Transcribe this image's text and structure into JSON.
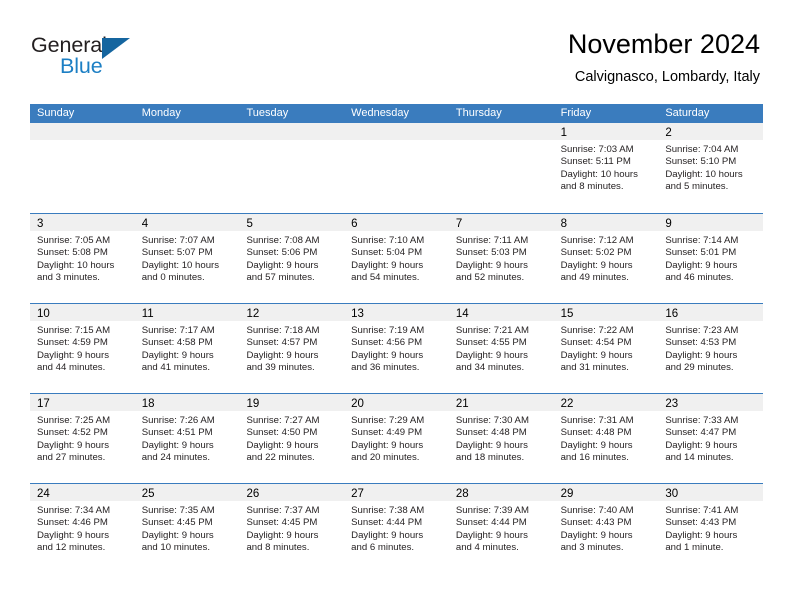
{
  "brand": {
    "name_part1": "General",
    "name_part2": "Blue"
  },
  "header": {
    "title": "November 2024",
    "location": "Calvignasco, Lombardy, Italy"
  },
  "colors": {
    "header_blue": "#3a7cbe",
    "day_band_gray": "#f0f0f0",
    "brand_dark": "#231f20",
    "brand_blue": "#1c7fc4",
    "logo_triangle": "#15659f"
  },
  "calendar": {
    "weekdays": [
      "Sunday",
      "Monday",
      "Tuesday",
      "Wednesday",
      "Thursday",
      "Friday",
      "Saturday"
    ],
    "weeks": [
      [
        {
          "day": "",
          "empty": true
        },
        {
          "day": "",
          "empty": true
        },
        {
          "day": "",
          "empty": true
        },
        {
          "day": "",
          "empty": true
        },
        {
          "day": "",
          "empty": true
        },
        {
          "day": "1",
          "sunrise": "Sunrise: 7:03 AM",
          "sunset": "Sunset: 5:11 PM",
          "daylight_line1": "Daylight: 10 hours",
          "daylight_line2": "and 8 minutes."
        },
        {
          "day": "2",
          "sunrise": "Sunrise: 7:04 AM",
          "sunset": "Sunset: 5:10 PM",
          "daylight_line1": "Daylight: 10 hours",
          "daylight_line2": "and 5 minutes."
        }
      ],
      [
        {
          "day": "3",
          "sunrise": "Sunrise: 7:05 AM",
          "sunset": "Sunset: 5:08 PM",
          "daylight_line1": "Daylight: 10 hours",
          "daylight_line2": "and 3 minutes."
        },
        {
          "day": "4",
          "sunrise": "Sunrise: 7:07 AM",
          "sunset": "Sunset: 5:07 PM",
          "daylight_line1": "Daylight: 10 hours",
          "daylight_line2": "and 0 minutes."
        },
        {
          "day": "5",
          "sunrise": "Sunrise: 7:08 AM",
          "sunset": "Sunset: 5:06 PM",
          "daylight_line1": "Daylight: 9 hours",
          "daylight_line2": "and 57 minutes."
        },
        {
          "day": "6",
          "sunrise": "Sunrise: 7:10 AM",
          "sunset": "Sunset: 5:04 PM",
          "daylight_line1": "Daylight: 9 hours",
          "daylight_line2": "and 54 minutes."
        },
        {
          "day": "7",
          "sunrise": "Sunrise: 7:11 AM",
          "sunset": "Sunset: 5:03 PM",
          "daylight_line1": "Daylight: 9 hours",
          "daylight_line2": "and 52 minutes."
        },
        {
          "day": "8",
          "sunrise": "Sunrise: 7:12 AM",
          "sunset": "Sunset: 5:02 PM",
          "daylight_line1": "Daylight: 9 hours",
          "daylight_line2": "and 49 minutes."
        },
        {
          "day": "9",
          "sunrise": "Sunrise: 7:14 AM",
          "sunset": "Sunset: 5:01 PM",
          "daylight_line1": "Daylight: 9 hours",
          "daylight_line2": "and 46 minutes."
        }
      ],
      [
        {
          "day": "10",
          "sunrise": "Sunrise: 7:15 AM",
          "sunset": "Sunset: 4:59 PM",
          "daylight_line1": "Daylight: 9 hours",
          "daylight_line2": "and 44 minutes."
        },
        {
          "day": "11",
          "sunrise": "Sunrise: 7:17 AM",
          "sunset": "Sunset: 4:58 PM",
          "daylight_line1": "Daylight: 9 hours",
          "daylight_line2": "and 41 minutes."
        },
        {
          "day": "12",
          "sunrise": "Sunrise: 7:18 AM",
          "sunset": "Sunset: 4:57 PM",
          "daylight_line1": "Daylight: 9 hours",
          "daylight_line2": "and 39 minutes."
        },
        {
          "day": "13",
          "sunrise": "Sunrise: 7:19 AM",
          "sunset": "Sunset: 4:56 PM",
          "daylight_line1": "Daylight: 9 hours",
          "daylight_line2": "and 36 minutes."
        },
        {
          "day": "14",
          "sunrise": "Sunrise: 7:21 AM",
          "sunset": "Sunset: 4:55 PM",
          "daylight_line1": "Daylight: 9 hours",
          "daylight_line2": "and 34 minutes."
        },
        {
          "day": "15",
          "sunrise": "Sunrise: 7:22 AM",
          "sunset": "Sunset: 4:54 PM",
          "daylight_line1": "Daylight: 9 hours",
          "daylight_line2": "and 31 minutes."
        },
        {
          "day": "16",
          "sunrise": "Sunrise: 7:23 AM",
          "sunset": "Sunset: 4:53 PM",
          "daylight_line1": "Daylight: 9 hours",
          "daylight_line2": "and 29 minutes."
        }
      ],
      [
        {
          "day": "17",
          "sunrise": "Sunrise: 7:25 AM",
          "sunset": "Sunset: 4:52 PM",
          "daylight_line1": "Daylight: 9 hours",
          "daylight_line2": "and 27 minutes."
        },
        {
          "day": "18",
          "sunrise": "Sunrise: 7:26 AM",
          "sunset": "Sunset: 4:51 PM",
          "daylight_line1": "Daylight: 9 hours",
          "daylight_line2": "and 24 minutes."
        },
        {
          "day": "19",
          "sunrise": "Sunrise: 7:27 AM",
          "sunset": "Sunset: 4:50 PM",
          "daylight_line1": "Daylight: 9 hours",
          "daylight_line2": "and 22 minutes."
        },
        {
          "day": "20",
          "sunrise": "Sunrise: 7:29 AM",
          "sunset": "Sunset: 4:49 PM",
          "daylight_line1": "Daylight: 9 hours",
          "daylight_line2": "and 20 minutes."
        },
        {
          "day": "21",
          "sunrise": "Sunrise: 7:30 AM",
          "sunset": "Sunset: 4:48 PM",
          "daylight_line1": "Daylight: 9 hours",
          "daylight_line2": "and 18 minutes."
        },
        {
          "day": "22",
          "sunrise": "Sunrise: 7:31 AM",
          "sunset": "Sunset: 4:48 PM",
          "daylight_line1": "Daylight: 9 hours",
          "daylight_line2": "and 16 minutes."
        },
        {
          "day": "23",
          "sunrise": "Sunrise: 7:33 AM",
          "sunset": "Sunset: 4:47 PM",
          "daylight_line1": "Daylight: 9 hours",
          "daylight_line2": "and 14 minutes."
        }
      ],
      [
        {
          "day": "24",
          "sunrise": "Sunrise: 7:34 AM",
          "sunset": "Sunset: 4:46 PM",
          "daylight_line1": "Daylight: 9 hours",
          "daylight_line2": "and 12 minutes."
        },
        {
          "day": "25",
          "sunrise": "Sunrise: 7:35 AM",
          "sunset": "Sunset: 4:45 PM",
          "daylight_line1": "Daylight: 9 hours",
          "daylight_line2": "and 10 minutes."
        },
        {
          "day": "26",
          "sunrise": "Sunrise: 7:37 AM",
          "sunset": "Sunset: 4:45 PM",
          "daylight_line1": "Daylight: 9 hours",
          "daylight_line2": "and 8 minutes."
        },
        {
          "day": "27",
          "sunrise": "Sunrise: 7:38 AM",
          "sunset": "Sunset: 4:44 PM",
          "daylight_line1": "Daylight: 9 hours",
          "daylight_line2": "and 6 minutes."
        },
        {
          "day": "28",
          "sunrise": "Sunrise: 7:39 AM",
          "sunset": "Sunset: 4:44 PM",
          "daylight_line1": "Daylight: 9 hours",
          "daylight_line2": "and 4 minutes."
        },
        {
          "day": "29",
          "sunrise": "Sunrise: 7:40 AM",
          "sunset": "Sunset: 4:43 PM",
          "daylight_line1": "Daylight: 9 hours",
          "daylight_line2": "and 3 minutes."
        },
        {
          "day": "30",
          "sunrise": "Sunrise: 7:41 AM",
          "sunset": "Sunset: 4:43 PM",
          "daylight_line1": "Daylight: 9 hours",
          "daylight_line2": "and 1 minute."
        }
      ]
    ]
  }
}
